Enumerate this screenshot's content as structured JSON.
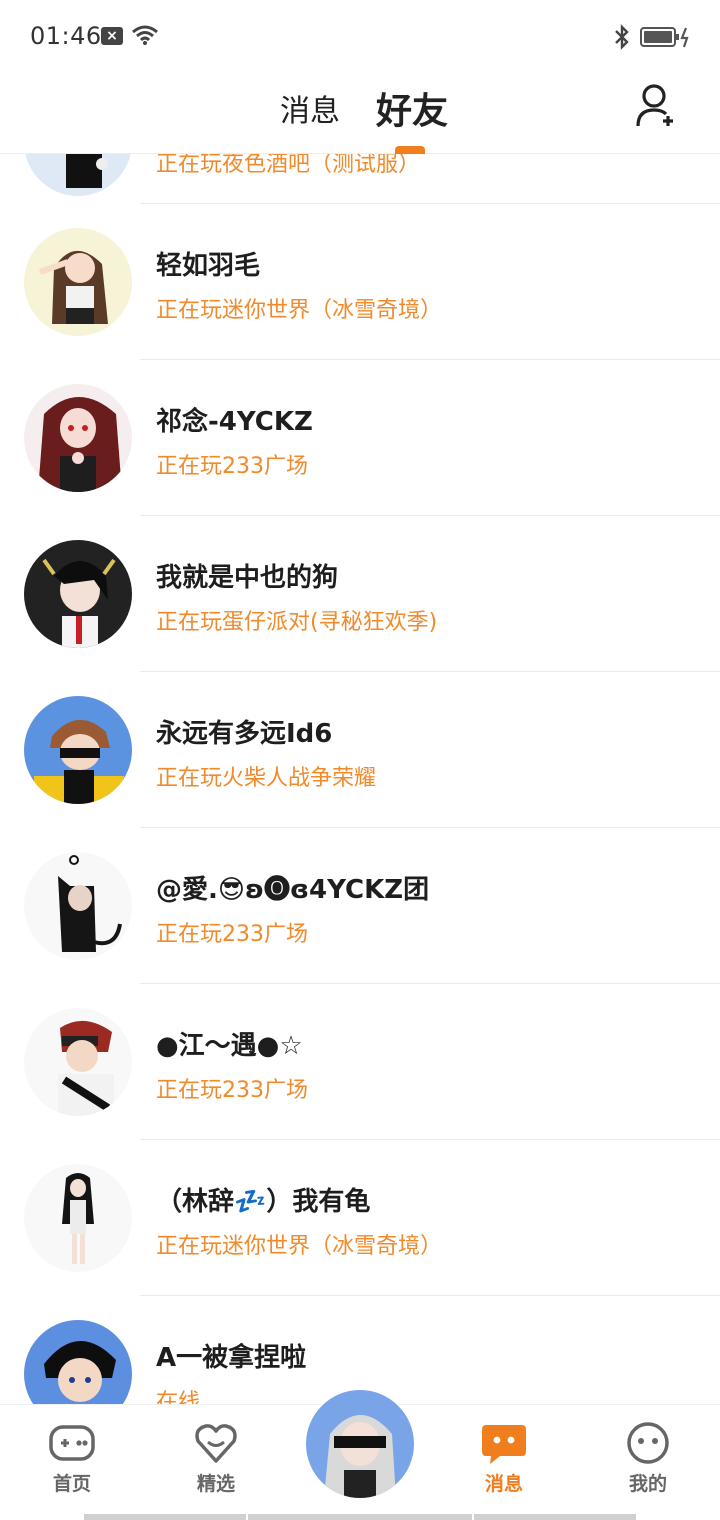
{
  "status_bar": {
    "time": "01:46",
    "notification_icon": "x-icon"
  },
  "header": {
    "tabs": [
      {
        "label": "消息",
        "active": false
      },
      {
        "label": "好友",
        "active": true
      }
    ],
    "add_friend_icon": "add-user-icon",
    "accent_color": "#f07d1e"
  },
  "partial_row": {
    "status": "正在玩夜色酒吧（测试服）"
  },
  "friends": [
    {
      "name": "轻如羽毛",
      "status": "正在玩迷你世界（冰雪奇境）"
    },
    {
      "name": "祁念-4YCKZ",
      "status": "正在玩233广场"
    },
    {
      "name": "我就是中也的狗",
      "status": "正在玩蛋仔派对(寻秘狂欢季)"
    },
    {
      "name": "永远有多远Id6",
      "status": "正在玩火柴人战争荣耀"
    },
    {
      "name": "@愛.😎ʚ🅞ɞ4YCKZ团",
      "status": "正在玩233广场"
    },
    {
      "name": "●江～遇●☆",
      "status": "正在玩233广场"
    },
    {
      "name": "（林辞💤）我有龟",
      "status": "正在玩迷你世界（冰雪奇境）"
    },
    {
      "name": "A一被拿捏啦",
      "status": "在线"
    }
  ],
  "bottom_nav": [
    {
      "label": "首页",
      "icon": "gamepad-icon",
      "active": false
    },
    {
      "label": "精选",
      "icon": "heart-icon",
      "active": false
    },
    {
      "label": "消息",
      "icon": "chat-bubble-icon",
      "active": true
    },
    {
      "label": "我的",
      "icon": "face-icon",
      "active": false
    }
  ]
}
